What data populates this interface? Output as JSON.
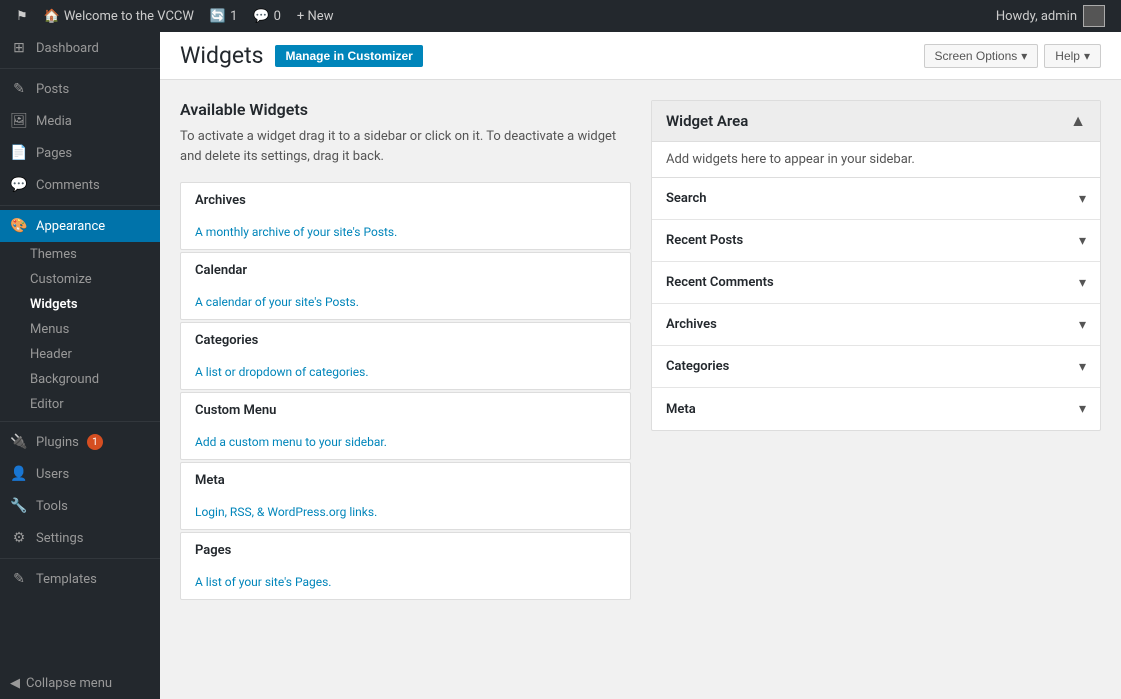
{
  "adminBar": {
    "logo": "⚑",
    "siteName": "Welcome to the VCCW",
    "updates": "1",
    "comments": "0",
    "newLabel": "+ New",
    "howdy": "Howdy, admin"
  },
  "sidebar": {
    "items": [
      {
        "id": "dashboard",
        "icon": "⊞",
        "label": "Dashboard"
      },
      {
        "id": "posts",
        "icon": "✎",
        "label": "Posts"
      },
      {
        "id": "media",
        "icon": "⊡",
        "label": "Media"
      },
      {
        "id": "pages",
        "icon": "📄",
        "label": "Pages"
      },
      {
        "id": "comments",
        "icon": "💬",
        "label": "Comments"
      },
      {
        "id": "appearance",
        "icon": "🎨",
        "label": "Appearance",
        "active": true
      },
      {
        "id": "plugins",
        "icon": "🔌",
        "label": "Plugins",
        "badge": "1"
      },
      {
        "id": "users",
        "icon": "👤",
        "label": "Users"
      },
      {
        "id": "tools",
        "icon": "🔧",
        "label": "Tools"
      },
      {
        "id": "settings",
        "icon": "⚙",
        "label": "Settings"
      },
      {
        "id": "templates",
        "icon": "✎",
        "label": "Templates"
      }
    ],
    "appearanceSubs": [
      {
        "id": "themes",
        "label": "Themes"
      },
      {
        "id": "customize",
        "label": "Customize"
      },
      {
        "id": "widgets",
        "label": "Widgets",
        "active": true
      },
      {
        "id": "menus",
        "label": "Menus"
      },
      {
        "id": "header",
        "label": "Header"
      },
      {
        "id": "background",
        "label": "Background"
      },
      {
        "id": "editor",
        "label": "Editor"
      }
    ],
    "collapseLabel": "Collapse menu"
  },
  "pageHeader": {
    "title": "Widgets",
    "manageLabel": "Manage in Customizer",
    "screenOptionsLabel": "Screen Options",
    "helpLabel": "Help"
  },
  "availableWidgets": {
    "sectionTitle": "Available Widgets",
    "description": "To activate a widget drag it to a sidebar or click on it. To deactivate a widget and delete its settings, drag it back.",
    "widgets": [
      {
        "title": "Archives",
        "desc": "A monthly archive of your site's Posts."
      },
      {
        "title": "Calendar",
        "desc": "A calendar of your site's Posts."
      },
      {
        "title": "Categories",
        "desc": "A list or dropdown of categories."
      },
      {
        "title": "Custom Menu",
        "desc": "Add a custom menu to your sidebar."
      },
      {
        "title": "Meta",
        "desc": "Login, RSS, & WordPress.org links."
      },
      {
        "title": "Pages",
        "desc": "A list of your site's Pages."
      }
    ]
  },
  "widgetArea": {
    "title": "Widget Area",
    "description": "Add widgets here to appear in your sidebar.",
    "widgets": [
      {
        "label": "Search"
      },
      {
        "label": "Recent Posts"
      },
      {
        "label": "Recent Comments"
      },
      {
        "label": "Archives"
      },
      {
        "label": "Categories"
      },
      {
        "label": "Meta"
      }
    ]
  }
}
